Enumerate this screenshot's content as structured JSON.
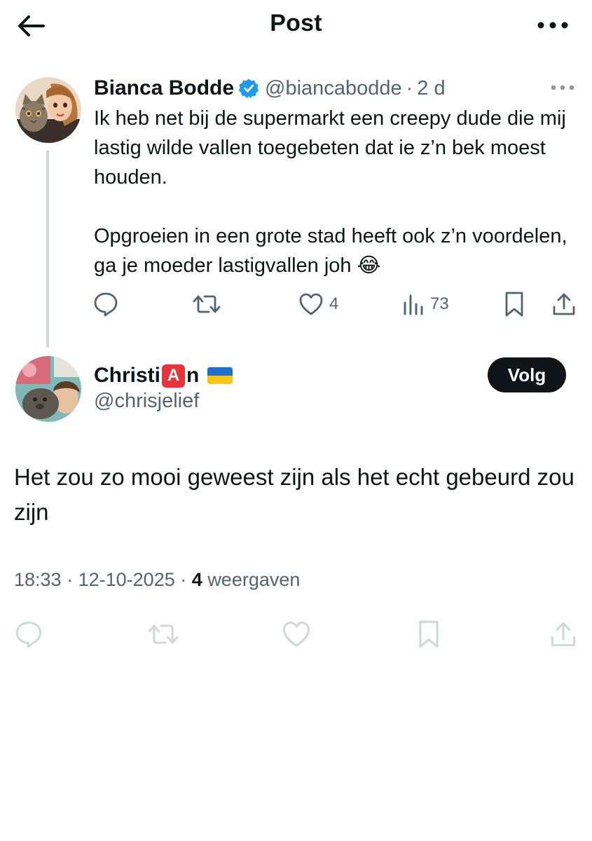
{
  "header": {
    "title": "Post",
    "back_icon": "arrow-left-icon",
    "more_icon": "more-horizontal-icon"
  },
  "parent_tweet": {
    "author_name": "Bianca Bodde",
    "verified": true,
    "handle": "@biancabodde",
    "separator": "·",
    "time_ago": "2 d",
    "text_paragraphs": [
      "Ik heb net bij de supermarkt een creepy dude die mij lastig wilde vallen toegebeten dat ie z’n bek moest houden.",
      "Opgroeien in een grote stad heeft ook z’n voordelen, ga je moeder lastigvallen joh 😂"
    ],
    "actions": {
      "likes": "4",
      "views": "73"
    }
  },
  "reply": {
    "name_prefix": "Christi",
    "name_badge": "A",
    "name_suffix": "n",
    "handle": "@chrisjelief",
    "follow_label": "Volg",
    "text": "Het zou zo mooi geweest zijn als het echt gebeurd zou zijn",
    "time": "18:33",
    "date": "12-10-2025",
    "separator": "·",
    "views_count": "4",
    "views_label": "weergaven"
  },
  "colors": {
    "text_primary": "#0f1419",
    "text_secondary": "#536471",
    "verified_blue": "#1d9bf0",
    "muted_icon": "#cfd9de",
    "thread_line": "#cfd9de"
  }
}
